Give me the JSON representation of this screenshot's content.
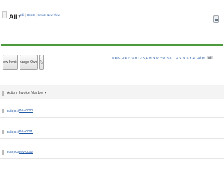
{
  "header": {
    "view_selected": "All",
    "view_links": {
      "edit": "Edit",
      "delete": "Delete",
      "create_new_view": "Create New View"
    },
    "help_icon": "help-icon"
  },
  "toolbar": {
    "new_invoice_label": "New Invoice",
    "change_owner_label": "Change Owner",
    "refresh_icon": "refresh-icon"
  },
  "alpha_filter": {
    "letters": [
      "A",
      "B",
      "C",
      "D",
      "E",
      "F",
      "G",
      "H",
      "I",
      "J",
      "K",
      "L",
      "M",
      "N",
      "O",
      "P",
      "Q",
      "R",
      "S",
      "T",
      "U",
      "V",
      "W",
      "X",
      "Y",
      "Z"
    ],
    "other_label": "Other",
    "all_label": "All"
  },
  "table": {
    "columns": {
      "action": "Action",
      "invoice_number": "Invoice Number",
      "sort_indicator": "▼"
    },
    "action_links": {
      "edit": "Edit",
      "del": "Del"
    },
    "rows": [
      {
        "invoice_number": "INV-0000"
      },
      {
        "invoice_number": "INV-0001"
      },
      {
        "invoice_number": "INV-0002"
      }
    ]
  },
  "colors": {
    "accent_green": "#4c9c3e",
    "link_blue": "#1f59a8"
  }
}
